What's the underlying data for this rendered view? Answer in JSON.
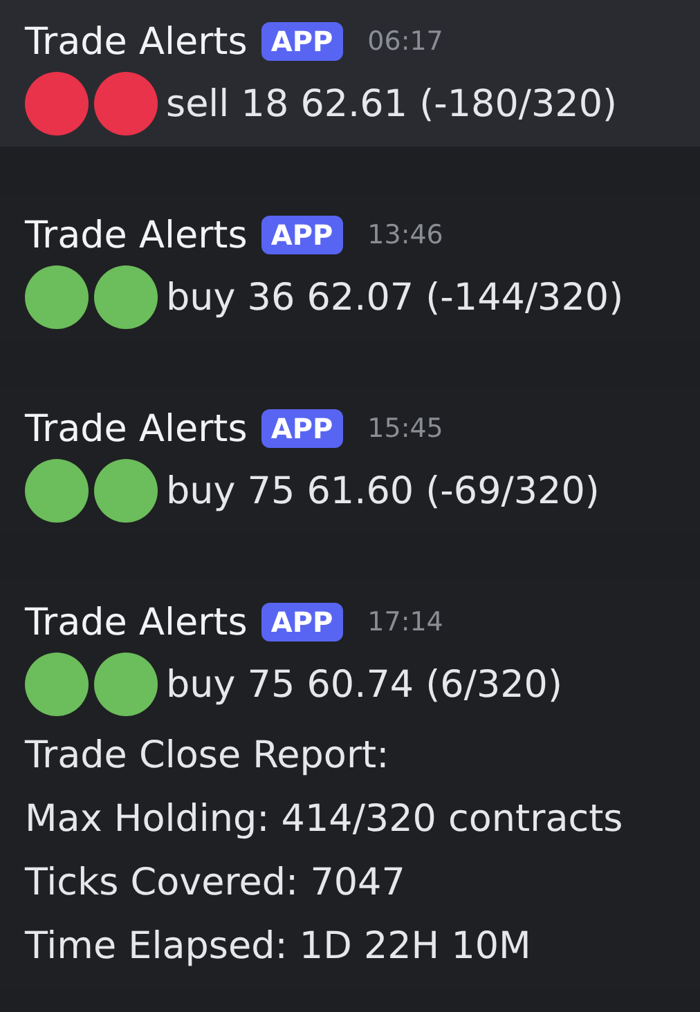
{
  "messages": [
    {
      "author": "Trade Alerts",
      "badge": "APP",
      "time": "06:17",
      "highlighted": true,
      "markers": [
        {
          "color": "#e8334a"
        },
        {
          "color": "#e8334a"
        }
      ],
      "text": "sell 18 62.61 (-180/320)"
    },
    {
      "author": "Trade Alerts",
      "badge": "APP",
      "time": "13:46",
      "highlighted": false,
      "markers": [
        {
          "color": "#6cbd5b"
        },
        {
          "color": "#6cbd5b"
        }
      ],
      "text": "buy 36 62.07 (-144/320)"
    },
    {
      "author": "Trade Alerts",
      "badge": "APP",
      "time": "15:45",
      "highlighted": false,
      "markers": [
        {
          "color": "#6cbd5b"
        },
        {
          "color": "#6cbd5b"
        }
      ],
      "text": "buy 75 61.60 (-69/320)"
    },
    {
      "author": "Trade Alerts",
      "badge": "APP",
      "time": "17:14",
      "highlighted": false,
      "markers": [
        {
          "color": "#6cbd5b"
        },
        {
          "color": "#6cbd5b"
        }
      ],
      "text": "buy 75 60.74 (6/320)",
      "report": [
        "Trade Close Report:",
        "Max Holding: 414/320 contracts",
        "Ticks Covered: 7047",
        "Time Elapsed: 1D 22H 10M"
      ]
    }
  ]
}
